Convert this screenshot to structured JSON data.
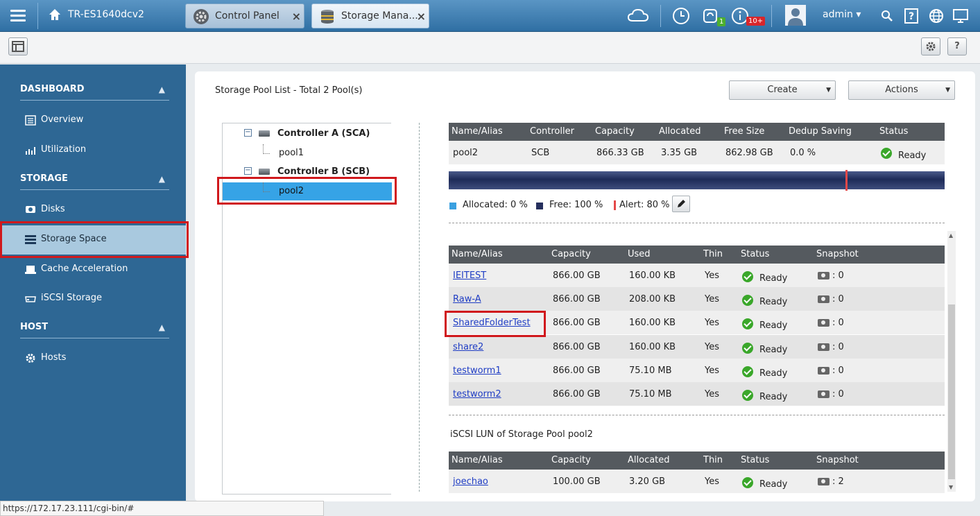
{
  "topbar": {
    "device_name": "TR-ES1640dcv2",
    "tabs": [
      {
        "label": "Control Panel",
        "close": "×"
      },
      {
        "label": "Storage Mana...",
        "close": "×"
      }
    ],
    "badges": {
      "sync": "1",
      "info": "10+"
    },
    "user": "admin ▾"
  },
  "sidebar": {
    "sections": [
      {
        "title": "DASHBOARD",
        "items": [
          {
            "label": "Overview"
          },
          {
            "label": "Utilization"
          }
        ]
      },
      {
        "title": "STORAGE",
        "items": [
          {
            "label": "Disks"
          },
          {
            "label": "Storage Space"
          },
          {
            "label": "Cache Acceleration"
          },
          {
            "label": "iSCSI Storage"
          }
        ]
      },
      {
        "title": "HOST",
        "items": [
          {
            "label": "Hosts"
          }
        ]
      }
    ]
  },
  "main": {
    "title": "Storage Pool List - Total 2 Pool(s)",
    "create_label": "Create",
    "actions_label": "Actions",
    "tree": {
      "controller_a": "Controller A (SCA)",
      "pool1": "pool1",
      "controller_b": "Controller B (SCB)",
      "pool2": "pool2"
    },
    "pool_table": {
      "headers": [
        "Name/Alias",
        "Controller",
        "Capacity",
        "Allocated",
        "Free Size",
        "Dedup Saving",
        "Status"
      ],
      "row": [
        "pool2",
        "SCB",
        "866.33 GB",
        "3.35 GB",
        "862.98 GB",
        "0.0 %",
        "Ready"
      ]
    },
    "capacity_bar": {
      "allocated_fraction": 0.0,
      "alert_fraction": 0.8
    },
    "legend": {
      "allocated": "Allocated: 0 %",
      "free": "Free: 100 %",
      "alert": "Alert: 80 %"
    },
    "folder_table": {
      "headers": [
        "Name/Alias",
        "Capacity",
        "Used",
        "Thin",
        "Status",
        "Snapshot"
      ],
      "rows": [
        [
          "IEITEST",
          "866.00 GB",
          "160.00 KB",
          "Yes",
          "Ready",
          ": 0"
        ],
        [
          "Raw-A",
          "866.00 GB",
          "208.00 KB",
          "Yes",
          "Ready",
          ": 0"
        ],
        [
          "SharedFolderTest",
          "866.00 GB",
          "160.00 KB",
          "Yes",
          "Ready",
          ": 0"
        ],
        [
          "share2",
          "866.00 GB",
          "160.00 KB",
          "Yes",
          "Ready",
          ": 0"
        ],
        [
          "testworm1",
          "866.00 GB",
          "75.10 MB",
          "Yes",
          "Ready",
          ": 0"
        ],
        [
          "testworm2",
          "866.00 GB",
          "75.10 MB",
          "Yes",
          "Ready",
          ": 0"
        ]
      ]
    },
    "lun_section_title": "iSCSI LUN of Storage Pool pool2",
    "lun_table": {
      "headers": [
        "Name/Alias",
        "Capacity",
        "Allocated",
        "Thin",
        "Status",
        "Snapshot"
      ],
      "rows": [
        [
          "joechao",
          "100.00 GB",
          "3.20 GB",
          "Yes",
          "Ready",
          ": 2"
        ]
      ]
    }
  },
  "statusbar": {
    "url": "https://172.17.23.111/cgi-bin/#"
  },
  "colors": {
    "sidebar": "#2e6794",
    "selected": "#36a3e6",
    "highlight": "#d0181c",
    "ok": "#3aa72a"
  }
}
